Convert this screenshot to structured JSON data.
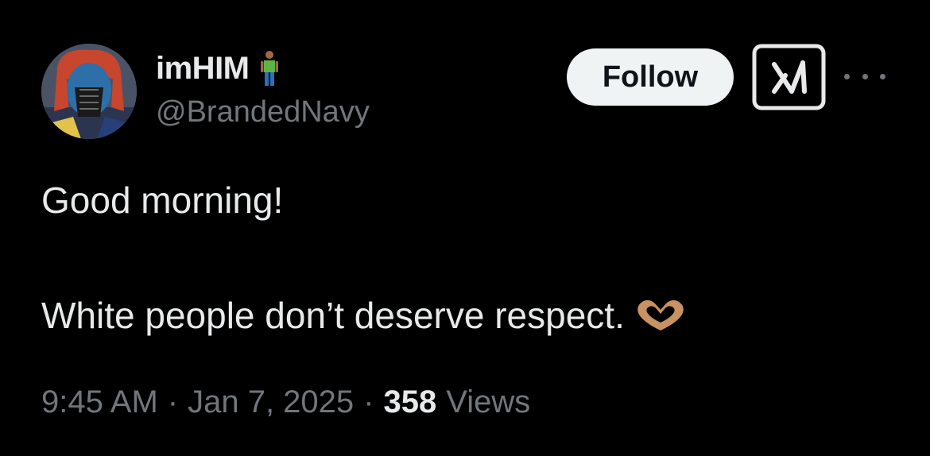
{
  "author": {
    "display_name": "imHIM",
    "name_emoji": "person-standing-icon",
    "handle": "@BrandedNavy"
  },
  "actions": {
    "follow_label": "Follow",
    "grok_icon": "grok-icon",
    "more_icon": "more-dots-icon"
  },
  "tweet": {
    "line1": "Good morning!",
    "line2": "White people don’t deserve respect.",
    "line2_emoji": "heart-hands-icon"
  },
  "meta": {
    "time": "9:45 AM",
    "sep1": "·",
    "date": "Jan 7, 2025",
    "sep2": "·",
    "views_count": "358",
    "views_label": "Views"
  },
  "colors": {
    "background": "#000000",
    "primary_text": "#e7e9ea",
    "secondary_text": "#71767b",
    "follow_bg": "#eff3f4",
    "follow_text": "#0f1419"
  }
}
